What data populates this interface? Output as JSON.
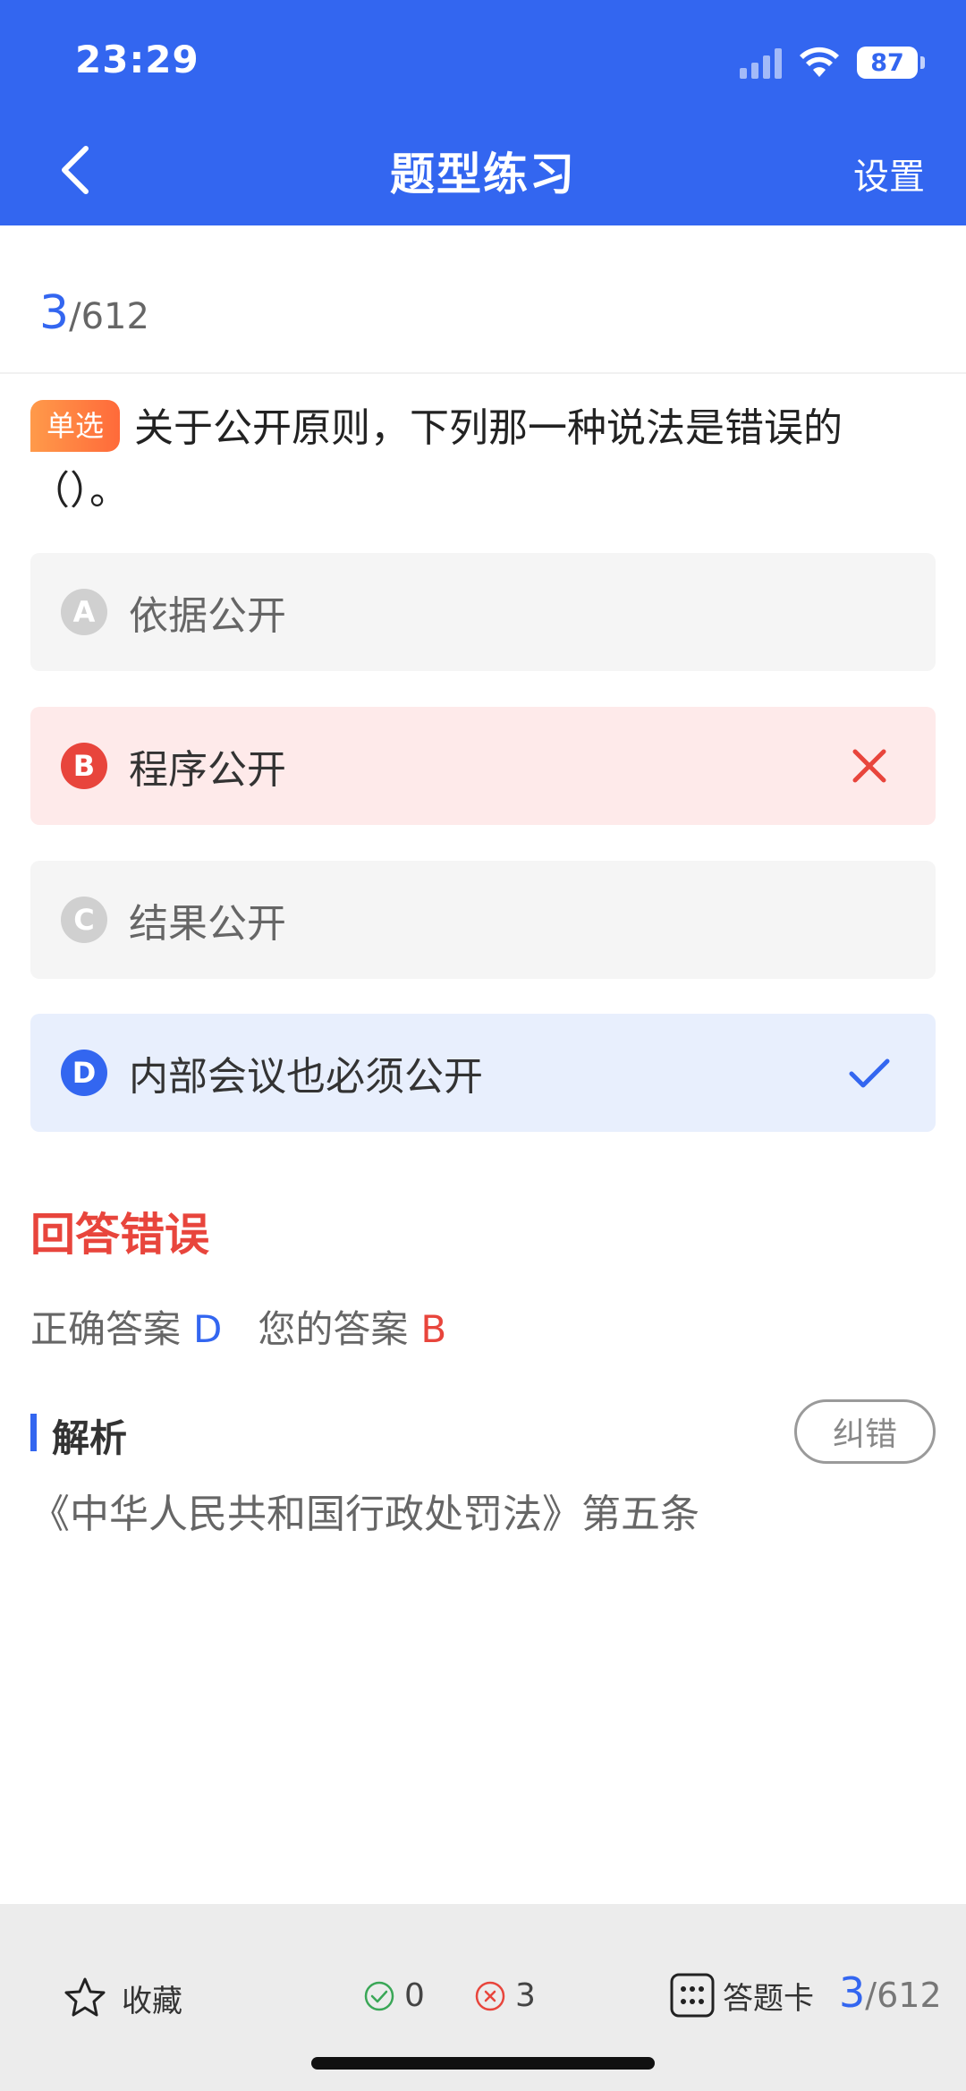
{
  "status_bar": {
    "time": "23:29",
    "battery": "87"
  },
  "nav": {
    "title": "题型练习",
    "settings_label": "设置"
  },
  "progress": {
    "current": "3",
    "total": "/612"
  },
  "question": {
    "type_label": "单选",
    "text": "关于公开原则，下列那一种说法是错误的（）。"
  },
  "options": [
    {
      "letter": "A",
      "text": "依据公开",
      "state": "normal"
    },
    {
      "letter": "B",
      "text": "程序公开",
      "state": "wrong"
    },
    {
      "letter": "C",
      "text": "结果公开",
      "state": "normal"
    },
    {
      "letter": "D",
      "text": "内部会议也必须公开",
      "state": "correct"
    }
  ],
  "result": {
    "title": "回答错误",
    "correct_label": "正确答案",
    "correct_value": "D",
    "your_label": "您的答案",
    "your_value": "B"
  },
  "analysis": {
    "title": "解析",
    "report_button": "纠错",
    "text": "《中华人民共和国行政处罚法》第五条"
  },
  "bottom_bar": {
    "favorite_label": "收藏",
    "correct_count": "0",
    "wrong_count": "3",
    "answer_card_label": "答题卡",
    "progress_current": "3",
    "progress_total": "/612"
  },
  "colors": {
    "primary": "#3366f0",
    "wrong": "#e8453c",
    "correct": "#3aa757"
  }
}
